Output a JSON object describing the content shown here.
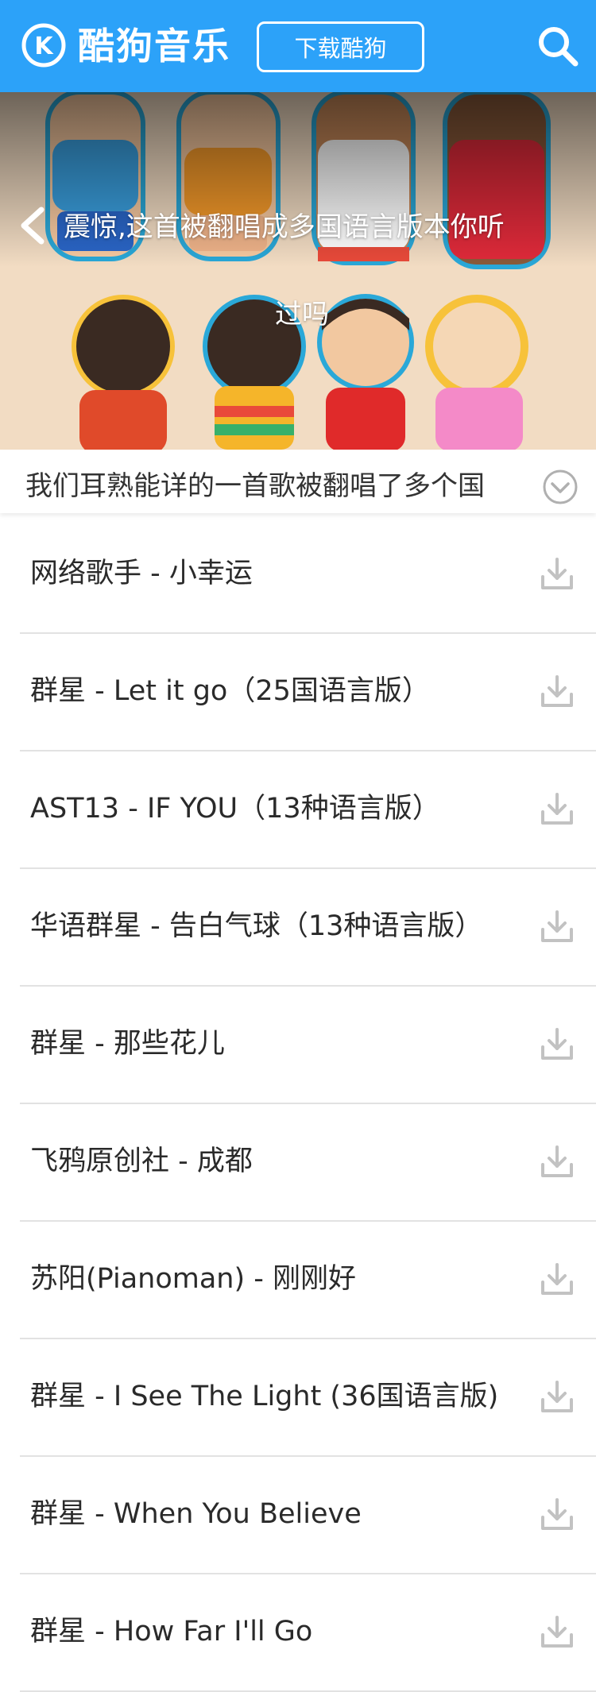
{
  "header": {
    "logo_text": "酷狗音乐",
    "logo_letter": "K",
    "download_button": "下载酷狗",
    "search_icon": "search-icon",
    "bg_color": "#2ca2f9"
  },
  "banner": {
    "title_line1": "震惊,这首被翻唱成多国语言版本你听",
    "title_line2": "过吗",
    "back_icon": "chevron-left-icon"
  },
  "description": {
    "text": "我们耳熟能详的一首歌被翻唱了多个国",
    "expand_icon": "chevron-down-circle-icon"
  },
  "songs": [
    {
      "title": "网络歌手 - 小幸运"
    },
    {
      "title": "群星 - Let it go（25国语言版）"
    },
    {
      "title": "AST13 - IF YOU（13种语言版）"
    },
    {
      "title": "华语群星 - 告白气球（13种语言版）"
    },
    {
      "title": "群星 - 那些花儿"
    },
    {
      "title": "飞鸦原创社 - 成都"
    },
    {
      "title": "苏阳(Pianoman) - 刚刚好"
    },
    {
      "title": "群星 - I See The Light (36国语言版)"
    },
    {
      "title": "群星 - When You Believe"
    },
    {
      "title": "群星 - How Far I'll Go"
    }
  ],
  "song_download_icon": "download-icon"
}
